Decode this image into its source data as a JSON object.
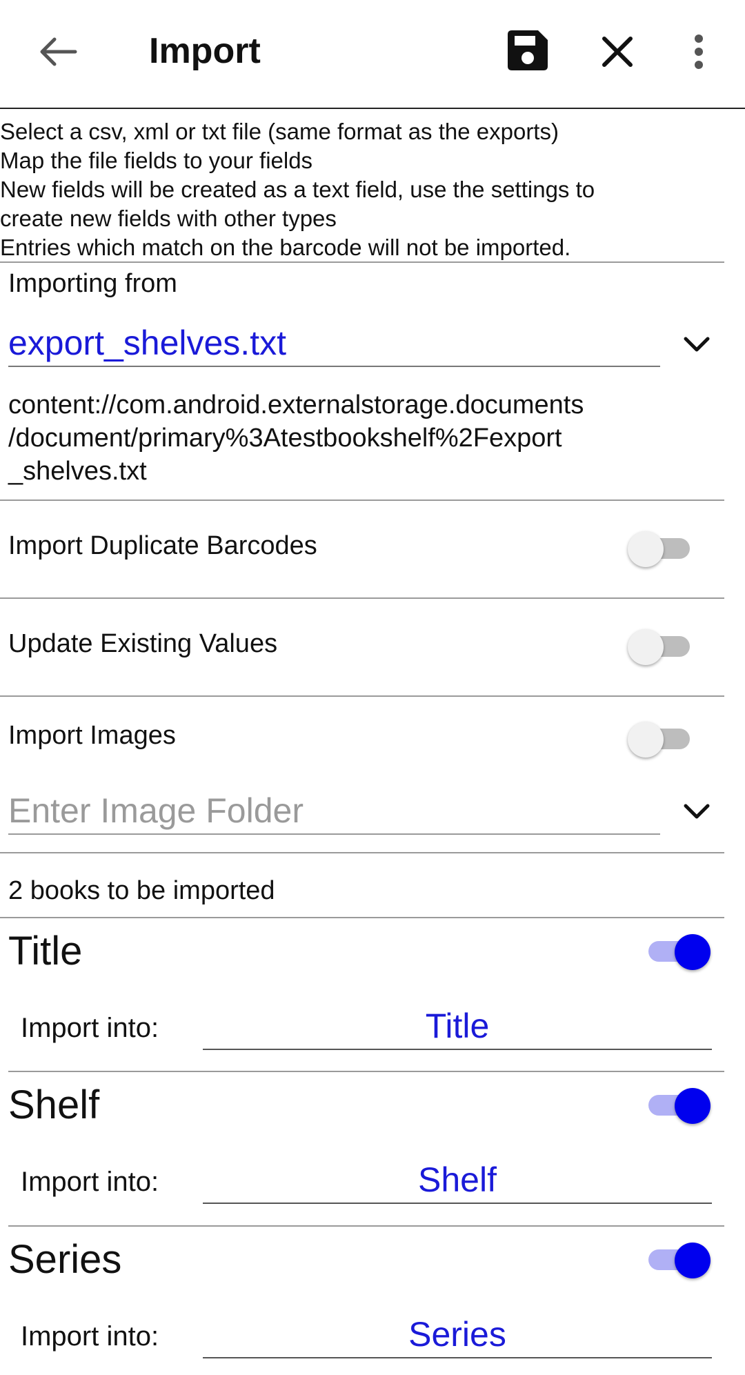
{
  "appbar": {
    "title": "Import",
    "back_icon": "arrow-back-icon",
    "save_icon": "save-icon",
    "close_icon": "close-icon",
    "more_icon": "more-vert-icon"
  },
  "instructions": {
    "lines": [
      "Select a csv, xml or txt file (same format as the exports)",
      "Map the file fields to your fields",
      "New fields will be created as a text field, use the settings to",
      "create new fields with other types",
      "Entries which match on the barcode will not be imported."
    ]
  },
  "source": {
    "label": "Importing from",
    "file": "export_shelves.txt",
    "uri_lines": [
      "content://com.android.externalstorage.documents",
      "/document/primary%3Atestbookshelf%2Fexport",
      "_shelves.txt"
    ]
  },
  "options": {
    "duplicate_label": "Import Duplicate Barcodes",
    "duplicate_on": false,
    "update_label": "Update Existing Values",
    "update_on": false,
    "images_label": "Import Images",
    "images_on": false,
    "folder_placeholder": "Enter Image Folder"
  },
  "summary": "2 books to be imported",
  "fields": [
    {
      "name": "Title",
      "import_label": "Import into:",
      "target": "Title",
      "enabled": true
    },
    {
      "name": "Shelf",
      "import_label": "Import into:",
      "target": "Shelf",
      "enabled": true
    },
    {
      "name": "Series",
      "import_label": "Import into:",
      "target": "Series",
      "enabled": true
    }
  ],
  "colors": {
    "accent": "#0000ee",
    "link_text": "#1a1ad8",
    "toggle_track_on": "#b0b0f5",
    "toggle_track_off": "#bdbdbd"
  }
}
